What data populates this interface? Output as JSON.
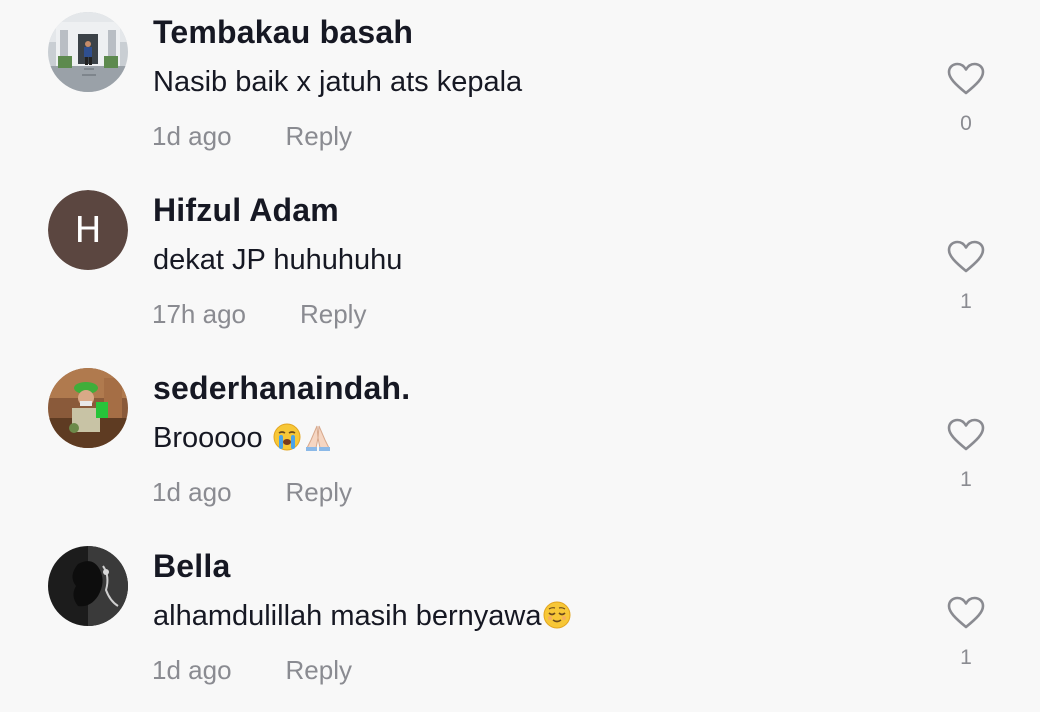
{
  "comments": [
    {
      "username": "Tembakau basah",
      "text": "Nasib baik x jatuh ats kepala",
      "time": "1d ago",
      "reply_label": "Reply",
      "likes": "0",
      "avatar": "photo-person-building-steps"
    },
    {
      "username": "Hifzul Adam",
      "text": "dekat JP huhuhuhu",
      "time": "17h ago",
      "reply_label": "Reply",
      "likes": "1",
      "avatar": "letter",
      "avatar_letter": "H",
      "avatar_color": "#5b4640"
    },
    {
      "username": "sederhanaindah.",
      "text": "Brooooo ",
      "emojis": [
        "loudly-crying-face",
        "folded-hands"
      ],
      "time": "1d ago",
      "reply_label": "Reply",
      "likes": "1",
      "avatar": "photo-person-green-cap"
    },
    {
      "username": "Bella",
      "text": "alhamdulillah masih bernyawa",
      "emojis": [
        "relieved-face"
      ],
      "time": "1d ago",
      "reply_label": "Reply",
      "likes": "1",
      "avatar": "photo-dark-silhouette"
    }
  ],
  "colors": {
    "background": "#f8f8f8",
    "primary_text": "#161823",
    "secondary_text": "#8a8b91"
  }
}
